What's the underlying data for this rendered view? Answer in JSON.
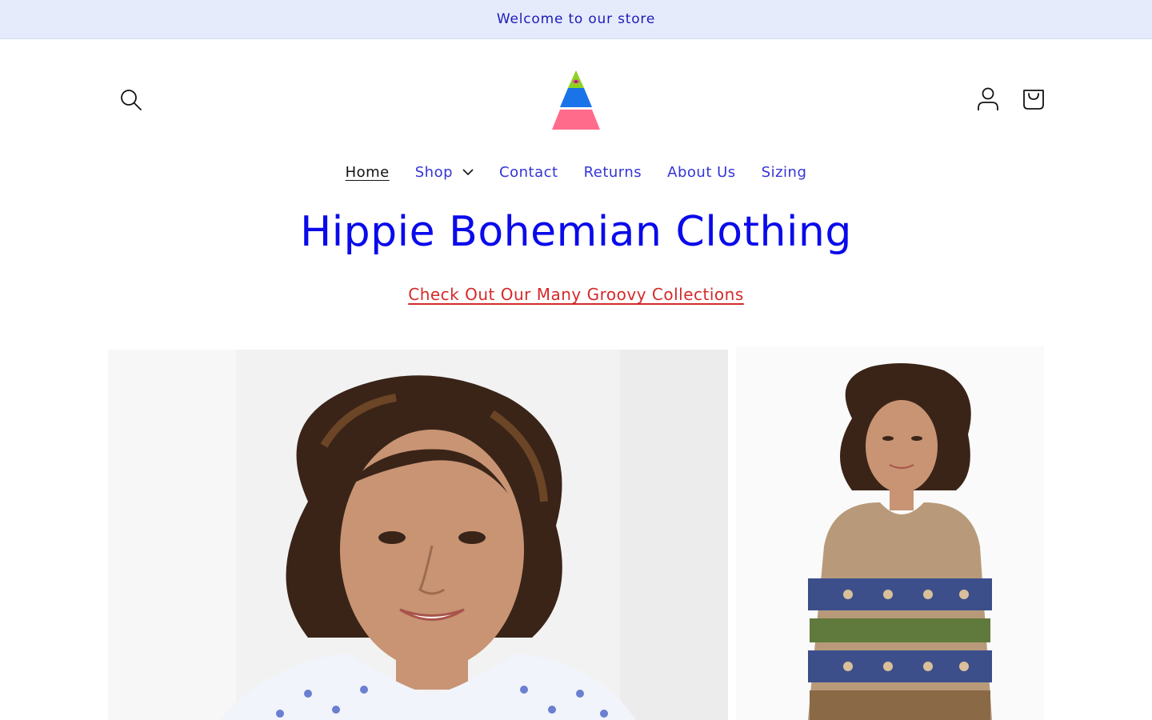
{
  "announcement": {
    "text": "Welcome to our store"
  },
  "header": {
    "search_icon": "search-icon",
    "account_icon": "account-icon",
    "cart_icon": "cart-icon",
    "logo_colors": [
      "#8ed321",
      "#1a73e8",
      "#ff6b8a"
    ]
  },
  "nav": {
    "items": [
      {
        "label": "Home",
        "active": true
      },
      {
        "label": "Shop",
        "has_dropdown": true
      },
      {
        "label": "Contact"
      },
      {
        "label": "Returns"
      },
      {
        "label": "About Us"
      },
      {
        "label": "Sizing"
      }
    ]
  },
  "hero": {
    "title": "Hippie Bohemian Clothing",
    "link": "Check Out Our Many Groovy Collections"
  },
  "colors": {
    "announcement_bg": "#e6ebfb",
    "nav_link": "#3434d6",
    "title": "#0a0aeb",
    "link": "#d42a2a"
  }
}
